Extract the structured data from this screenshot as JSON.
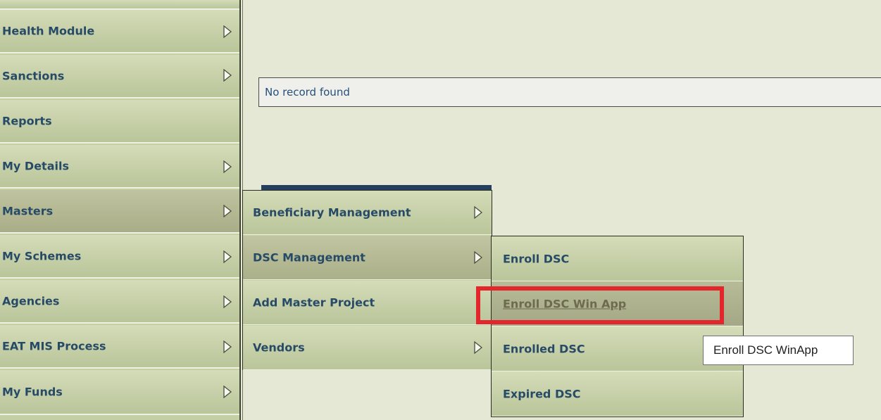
{
  "sidebar": {
    "items": [
      {
        "label": "Health Module",
        "has_submenu": true
      },
      {
        "label": "Sanctions",
        "has_submenu": true
      },
      {
        "label": "Reports",
        "has_submenu": false
      },
      {
        "label": "My Details",
        "has_submenu": true
      },
      {
        "label": "Masters",
        "has_submenu": true,
        "active": true
      },
      {
        "label": "My Schemes",
        "has_submenu": true
      },
      {
        "label": "Agencies",
        "has_submenu": true
      },
      {
        "label": "EAT MIS Process",
        "has_submenu": true
      },
      {
        "label": "My Funds",
        "has_submenu": true
      }
    ]
  },
  "main": {
    "empty_message": "No record found"
  },
  "masters_submenu": {
    "items": [
      {
        "label": "Beneficiary Management",
        "has_submenu": true
      },
      {
        "label": "DSC Management",
        "has_submenu": true,
        "active": true
      },
      {
        "label": "Add Master Project",
        "has_submenu": false
      },
      {
        "label": "Vendors",
        "has_submenu": true
      }
    ]
  },
  "dsc_submenu": {
    "items": [
      {
        "label": "Enroll DSC"
      },
      {
        "label": "Enroll DSC Win App",
        "hovered": true
      },
      {
        "label": "Enrolled DSC"
      },
      {
        "label": "Expired DSC"
      }
    ]
  },
  "tooltip": {
    "text": "Enroll DSC WinApp"
  },
  "colors": {
    "menu_text": "#274a66",
    "menu_bg": "#c5cfa6",
    "highlight": "#e3262c",
    "page_bg": "#e4e8d4"
  }
}
